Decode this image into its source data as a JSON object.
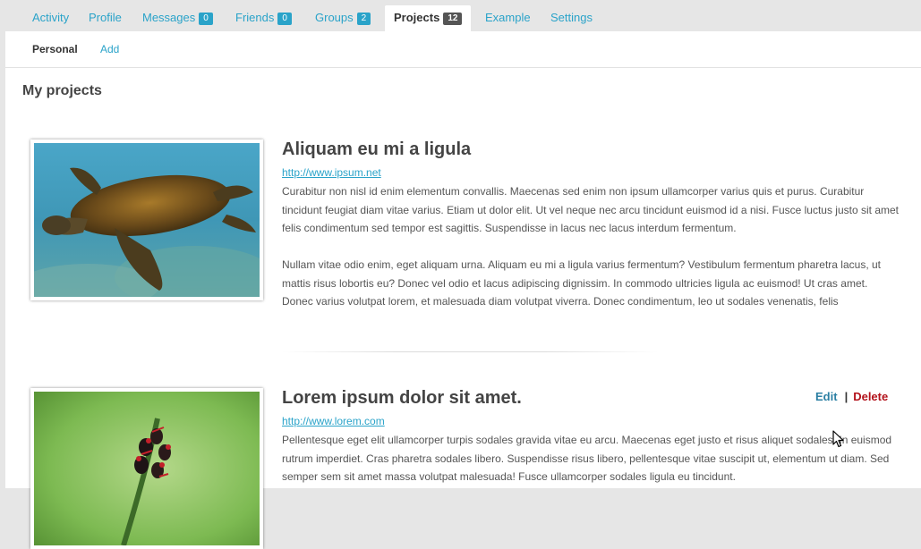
{
  "tabs": [
    {
      "label": "Activity"
    },
    {
      "label": "Profile"
    },
    {
      "label": "Messages",
      "badge": "0"
    },
    {
      "label": "Friends",
      "badge": "0"
    },
    {
      "label": "Groups",
      "badge": "2"
    },
    {
      "label": "Projects",
      "badge": "12",
      "active": true
    },
    {
      "label": "Example"
    },
    {
      "label": "Settings"
    }
  ],
  "subnav": {
    "personal": "Personal",
    "add": "Add"
  },
  "page_title": "My projects",
  "projects": [
    {
      "title": "Aliquam eu mi a ligula",
      "url": "http://www.ipsum.net",
      "desc1": "Curabitur non nisl id enim elementum convallis. Maecenas sed enim non ipsum ullamcorper varius quis et purus. Curabitur tincidunt feugiat diam vitae varius. Etiam ut dolor elit. Ut vel neque nec arcu tincidunt euismod id a nisi. Fusce luctus justo sit amet felis condimentum sed tempor est sagittis. Suspendisse in lacus nec lacus interdum fermentum.",
      "desc2": "Nullam vitae odio enim, eget aliquam urna. Aliquam eu mi a ligula varius fermentum? Vestibulum fermentum pharetra lacus, ut mattis risus lobortis eu? Donec vel odio et lacus adipiscing dignissim. In commodo ultricies ligula ac euismod! Ut cras amet. Donec varius volutpat lorem, et malesuada diam volutpat viverra. Donec condimentum, leo ut sodales venenatis, felis",
      "image": "sea-turtle"
    },
    {
      "title": "Lorem ipsum dolor sit amet.",
      "url": "http://www.lorem.com",
      "desc1": "Pellentesque eget elit ullamcorper turpis sodales gravida vitae eu arcu. Maecenas eget justo et risus aliquet sodales. In euismod rutrum imperdiet. Cras pharetra sodales libero. Suspendisse risus libero, pellentesque vitae suscipit ut, elementum ut diam. Sed semper sem sit amet massa volutpat malesuada! Fusce ullamcorper sodales ligula eu tincidunt.",
      "image": "ladybugs-on-stem",
      "edit_label": "Edit",
      "separator": "|",
      "delete_label": "Delete"
    }
  ],
  "colors": {
    "accent": "#2aa3c9",
    "delete": "#b3121b",
    "edit": "#2b7fa3"
  }
}
